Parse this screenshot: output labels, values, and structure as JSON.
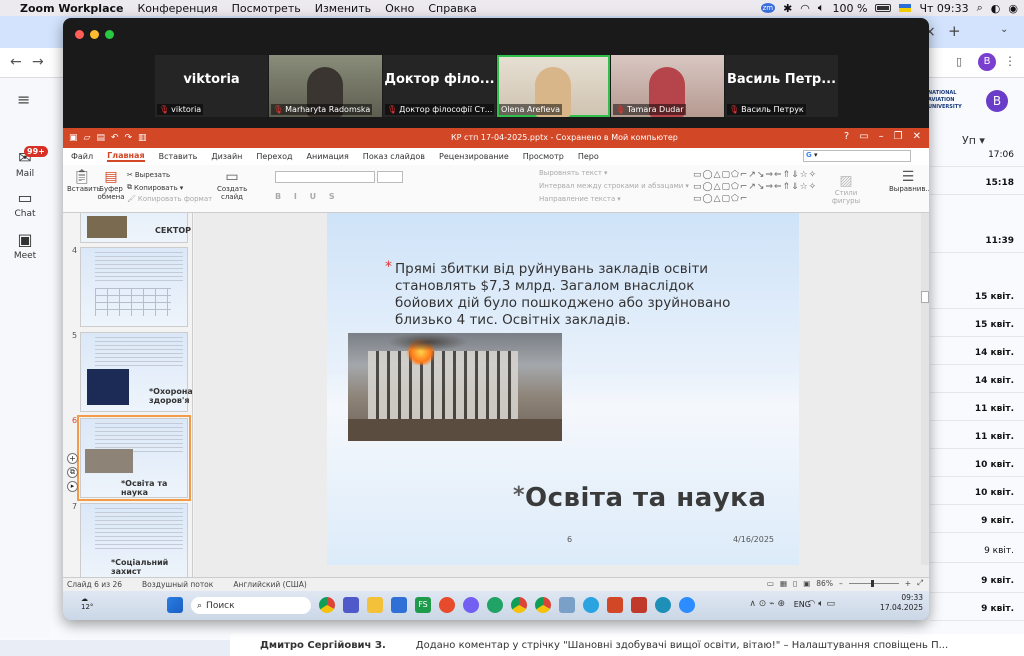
{
  "menubar": {
    "app": "Zoom Workplace",
    "items": [
      "Конференция",
      "Посмотреть",
      "Изменить",
      "Окно",
      "Справка"
    ],
    "battery": "100 %",
    "clock": "Чт 09:33"
  },
  "gmail": {
    "mail_label": "Mail",
    "badge": "99+",
    "chat_label": "Chat",
    "meet_label": "Meet",
    "sort_label": "Уп",
    "dates": [
      "17:06",
      "15:18",
      "11:39",
      "15 квіт.",
      "15 квіт.",
      "14 квіт.",
      "14 квіт.",
      "11 квіт.",
      "11 квіт.",
      "10 квіт.",
      "10 квіт.",
      "9 квіт.",
      "9 квіт.",
      "9 квіт.",
      "9 квіт."
    ],
    "bottom_row": {
      "sender": "Дмитро Сергійович З.",
      "text": "Додано коментар у стрічку \"Шановні здобувачі вищої освіти, вітаю!\" – Налаштування сповіщень П..."
    },
    "avatar_letter": "B"
  },
  "zoom": {
    "participants": [
      {
        "big": "viktoria",
        "name": "viktoria",
        "video": false
      },
      {
        "big": "",
        "name": "Marharyta Radomska",
        "video": true
      },
      {
        "big": "Доктор філо...",
        "name": "Доктор філософії Ст...",
        "video": false
      },
      {
        "big": "",
        "name": "Olena Arefieva",
        "video": true,
        "active": true
      },
      {
        "big": "",
        "name": "Tamara Dudar",
        "video": true
      },
      {
        "big": "Василь Петр...",
        "name": "Василь Петрук",
        "video": false
      }
    ]
  },
  "ppt": {
    "title": "КР стп 17-04-2025.pptx - Сохранено в Мой компьютер",
    "tabs": [
      "Файл",
      "Главная",
      "Вставить",
      "Дизайн",
      "Переход",
      "Анимация",
      "Показ слайдов",
      "Рецензирование",
      "Просмотр",
      "Перо"
    ],
    "selected_tab": "Главная",
    "ribbon": {
      "paste": "Вставить",
      "clipboard": "Буфер обмена",
      "cut": "Вырезать",
      "copy": "Копировать",
      "format_copy": "Копировать формат",
      "create_slide": "Создать слайд",
      "align_text": "Выровнять текст",
      "line_spacing": "Интервал между строками и абзацами",
      "text_direction": "Направление текста",
      "styles": "Стили фигуры",
      "arrange": "Выравнив..."
    },
    "thumbnails": [
      {
        "num": "",
        "caption": "СЕКТОР"
      },
      {
        "num": "4",
        "caption": ""
      },
      {
        "num": "5",
        "caption": "*Охорона здоров'я"
      },
      {
        "num": "6",
        "caption": "*Освіта та наука",
        "selected": true
      },
      {
        "num": "7",
        "caption": "*Соціальний захист"
      }
    ],
    "slide": {
      "body": "Прямі збитки від руйнувань закладів освіти становлять $7,3 млрд. Загалом внаслідок бойових дій було пошкоджено або зруйновано близько 4 тис. Освітніх закладів.",
      "title": "Освіта та наука",
      "number": "6",
      "date": "4/16/2025"
    },
    "status": {
      "slide": "Слайд 6 из 26",
      "theme": "Воздушный поток",
      "lang": "Английский (США)",
      "zoom": "86%"
    }
  },
  "taskbar": {
    "weather": "12°",
    "search": "Поиск",
    "lang": "ENG",
    "time": "09:33",
    "date": "17.04.2025"
  },
  "colors": {
    "ppt_accent": "#d24726",
    "zoom_active": "#2fbf4a",
    "gmail_badge": "#d93025"
  }
}
